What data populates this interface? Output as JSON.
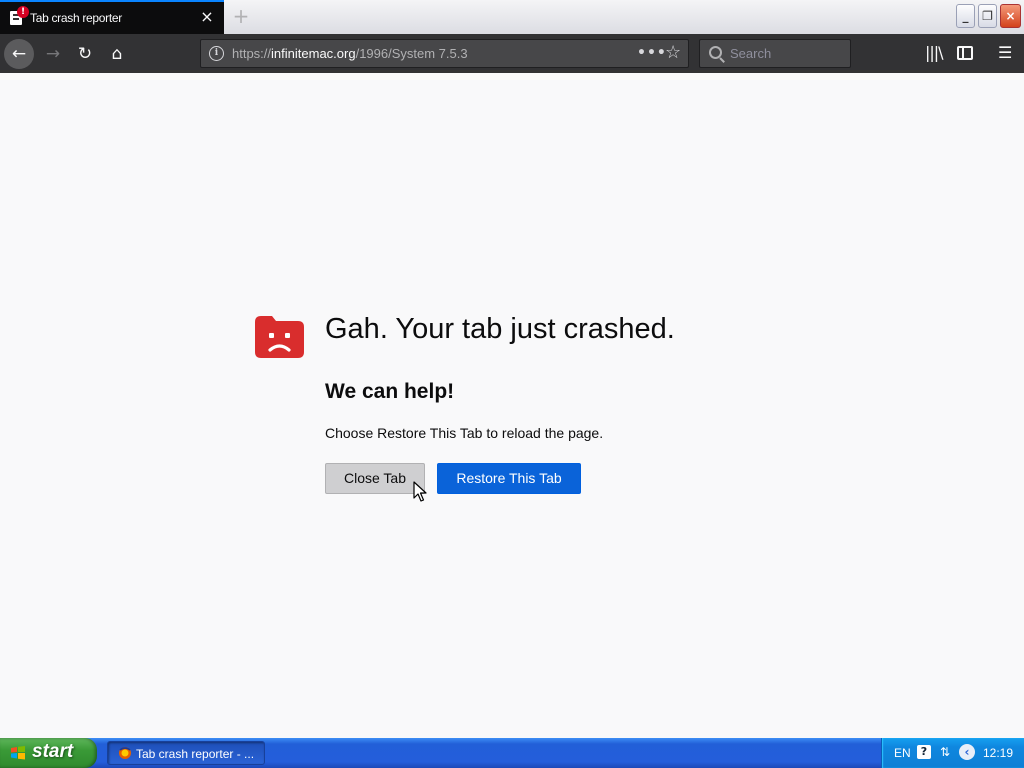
{
  "tab": {
    "title": "Tab crash reporter",
    "alert_badge": "!",
    "close_glyph": "×"
  },
  "new_tab_glyph": "+",
  "window_controls": {
    "minimize": "_",
    "maximize": "❐",
    "close": "×"
  },
  "toolbar": {
    "back_glyph": "←",
    "forward_glyph": "→",
    "reload_glyph": "↻",
    "home_glyph": "⌂",
    "url_info_glyph": "i",
    "url_prefix": "https://",
    "url_host": "infinitemac.org",
    "url_path": "/1996/System 7.5.3",
    "page_actions_glyph": "•••",
    "bookmark_glyph": "☆",
    "search_placeholder": "Search",
    "library_glyph": "|||\\",
    "menu_glyph": "☰"
  },
  "crash": {
    "title": "Gah. Your tab just crashed.",
    "subtitle": "We can help!",
    "message": "Choose Restore This Tab to reload the page.",
    "close_button": "Close Tab",
    "restore_button": "Restore This Tab"
  },
  "taskbar": {
    "start_label": "start",
    "task_label": "Tab crash reporter - ...",
    "language": "EN",
    "help_glyph": "?",
    "network_glyph": "⇅",
    "chevron_glyph": "‹",
    "clock": "12:19"
  },
  "colors": {
    "accent_blue": "#0a84ff",
    "restore_button": "#0a63d9",
    "crash_icon": "#d92d2d",
    "toolbar": "#323234",
    "taskbar_blue": "#245edb",
    "start_green": "#3a9a37"
  }
}
